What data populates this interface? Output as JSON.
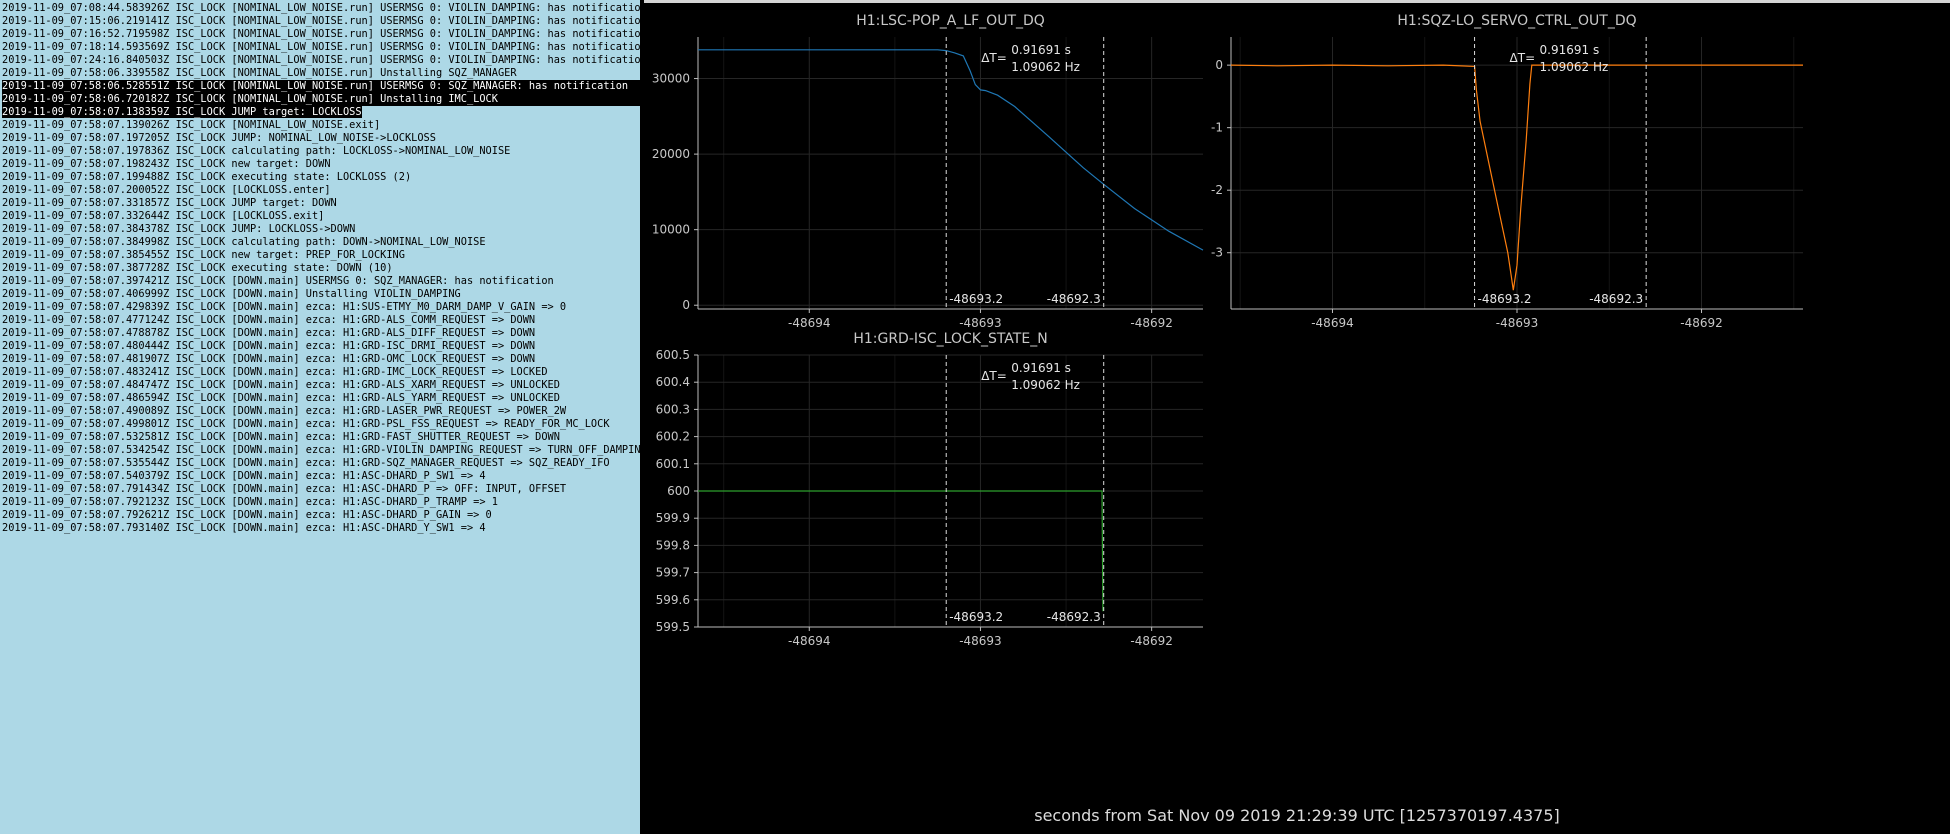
{
  "log": {
    "lines": [
      "2019-11-09_07:08:44.583926Z ISC_LOCK [NOMINAL_LOW_NOISE.run] USERMSG 0: VIOLIN_DAMPING: has notification",
      "2019-11-09_07:15:06.219141Z ISC_LOCK [NOMINAL_LOW_NOISE.run] USERMSG 0: VIOLIN_DAMPING: has notification",
      "2019-11-09_07:16:52.719598Z ISC_LOCK [NOMINAL_LOW_NOISE.run] USERMSG 0: VIOLIN_DAMPING: has notification",
      "2019-11-09_07:18:14.593569Z ISC_LOCK [NOMINAL_LOW_NOISE.run] USERMSG 0: VIOLIN_DAMPING: has notification",
      "2019-11-09_07:24:16.840503Z ISC_LOCK [NOMINAL_LOW_NOISE.run] USERMSG 0: VIOLIN_DAMPING: has notification",
      "2019-11-09_07:58:06.339558Z ISC_LOCK [NOMINAL_LOW_NOISE.run] Unstalling SQZ_MANAGER",
      "2019-11-09_07:58:06.528551Z ISC_LOCK [NOMINAL_LOW_NOISE.run] USERMSG 0: SQZ_MANAGER: has notification",
      "2019-11-09_07:58:06.720182Z ISC_LOCK [NOMINAL_LOW_NOISE.run] Unstalling IMC_LOCK",
      "2019-11-09_07:58:07.138359Z ISC_LOCK JUMP target: LOCKLOSS",
      "2019-11-09_07:58:07.139026Z ISC_LOCK [NOMINAL_LOW_NOISE.exit]",
      "2019-11-09_07:58:07.197205Z ISC_LOCK JUMP: NOMINAL_LOW_NOISE->LOCKLOSS",
      "2019-11-09_07:58:07.197836Z ISC_LOCK calculating path: LOCKLOSS->NOMINAL_LOW_NOISE",
      "2019-11-09_07:58:07.198243Z ISC_LOCK new target: DOWN",
      "2019-11-09_07:58:07.199488Z ISC_LOCK executing state: LOCKLOSS (2)",
      "2019-11-09_07:58:07.200052Z ISC_LOCK [LOCKLOSS.enter]",
      "2019-11-09_07:58:07.331857Z ISC_LOCK JUMP target: DOWN",
      "2019-11-09_07:58:07.332644Z ISC_LOCK [LOCKLOSS.exit]",
      "2019-11-09_07:58:07.384378Z ISC_LOCK JUMP: LOCKLOSS->DOWN",
      "2019-11-09_07:58:07.384998Z ISC_LOCK calculating path: DOWN->NOMINAL_LOW_NOISE",
      "2019-11-09_07:58:07.385455Z ISC_LOCK new target: PREP_FOR_LOCKING",
      "2019-11-09_07:58:07.387728Z ISC_LOCK executing state: DOWN (10)",
      "2019-11-09_07:58:07.397421Z ISC_LOCK [DOWN.main] USERMSG 0: SQZ_MANAGER: has notification",
      "2019-11-09_07:58:07.406999Z ISC_LOCK [DOWN.main] Unstalling VIOLIN_DAMPING",
      "2019-11-09_07:58:07.429839Z ISC_LOCK [DOWN.main] ezca: H1:SUS-ETMY_M0_DARM_DAMP_V_GAIN => 0",
      "2019-11-09_07:58:07.477124Z ISC_LOCK [DOWN.main] ezca: H1:GRD-ALS_COMM_REQUEST => DOWN",
      "2019-11-09_07:58:07.478878Z ISC_LOCK [DOWN.main] ezca: H1:GRD-ALS_DIFF_REQUEST => DOWN",
      "2019-11-09_07:58:07.480444Z ISC_LOCK [DOWN.main] ezca: H1:GRD-ISC_DRMI_REQUEST => DOWN",
      "2019-11-09_07:58:07.481907Z ISC_LOCK [DOWN.main] ezca: H1:GRD-OMC_LOCK_REQUEST => DOWN",
      "2019-11-09_07:58:07.483241Z ISC_LOCK [DOWN.main] ezca: H1:GRD-IMC_LOCK_REQUEST => LOCKED",
      "2019-11-09_07:58:07.484747Z ISC_LOCK [DOWN.main] ezca: H1:GRD-ALS_XARM_REQUEST => UNLOCKED",
      "2019-11-09_07:58:07.486594Z ISC_LOCK [DOWN.main] ezca: H1:GRD-ALS_YARM_REQUEST => UNLOCKED",
      "2019-11-09_07:58:07.490089Z ISC_LOCK [DOWN.main] ezca: H1:GRD-LASER_PWR_REQUEST => POWER_2W",
      "2019-11-09_07:58:07.499801Z ISC_LOCK [DOWN.main] ezca: H1:GRD-PSL_FSS_REQUEST => READY_FOR_MC_LOCK",
      "2019-11-09_07:58:07.532581Z ISC_LOCK [DOWN.main] ezca: H1:GRD-FAST_SHUTTER_REQUEST => DOWN",
      "2019-11-09_07:58:07.534254Z ISC_LOCK [DOWN.main] ezca: H1:GRD-VIOLIN_DAMPING_REQUEST => TURN_OFF_DAMPING_A",
      "2019-11-09_07:58:07.535544Z ISC_LOCK [DOWN.main] ezca: H1:GRD-SQZ_MANAGER_REQUEST => SQZ_READY_IFO",
      "2019-11-09_07:58:07.540379Z ISC_LOCK [DOWN.main] ezca: H1:ASC-DHARD_P_SW1 => 4",
      "2019-11-09_07:58:07.791434Z ISC_LOCK [DOWN.main] ezca: H1:ASC-DHARD_P => OFF: INPUT, OFFSET",
      "2019-11-09_07:58:07.792123Z ISC_LOCK [DOWN.main] ezca: H1:ASC-DHARD_P_TRAMP => 1",
      "2019-11-09_07:58:07.792621Z ISC_LOCK [DOWN.main] ezca: H1:ASC-DHARD_P_GAIN => 0",
      "2019-11-09_07:58:07.793140Z ISC_LOCK [DOWN.main] ezca: H1:ASC-DHARD_Y_SW1 => 4"
    ],
    "selected_lines": [
      6,
      7
    ],
    "partial_selected_line": 8
  },
  "colors": {
    "log_bg": "#add8e6",
    "plot_bg": "#000000",
    "grid": "#262626",
    "axis": "#bdbdbd",
    "series_blue": "#1f77b4",
    "series_orange": "#ff7f0e",
    "series_green": "#2ca02c"
  },
  "cursors": {
    "t1_label": "-48693.2",
    "t2_label": "-48692.3",
    "delta_prefix": "ΔT=",
    "delta_time": "0.91691 s",
    "delta_freq": "1.09062 Hz"
  },
  "footer": "seconds from Sat Nov 09 2019 21:29:39 UTC [1257370197.4375]",
  "chart_data": [
    {
      "type": "line",
      "title": "H1:LSC-POP_A_LF_OUT_DQ",
      "xlim": [
        -48694.65,
        -48691.7
      ],
      "ylim": [
        -500,
        35500
      ],
      "xticks": [
        -48694,
        -48693,
        -48692
      ],
      "yticks": [
        0,
        10000,
        20000,
        30000
      ],
      "cursor_x": [
        -48693.2,
        -48692.28
      ],
      "series": [
        {
          "color": "#1f77b4",
          "x": [
            -48694.65,
            -48693.8,
            -48693.5,
            -48693.25,
            -48693.2,
            -48693.15,
            -48693.1,
            -48693.06,
            -48693.03,
            -48693.0,
            -48692.97,
            -48692.9,
            -48692.8,
            -48692.6,
            -48692.4,
            -48692.28,
            -48692.1,
            -48691.9,
            -48691.7
          ],
          "y": [
            33800,
            33800,
            33800,
            33800,
            33700,
            33400,
            33000,
            31000,
            29200,
            28500,
            28400,
            27800,
            26300,
            22300,
            18200,
            16000,
            12800,
            9800,
            7300
          ]
        }
      ]
    },
    {
      "type": "line",
      "title": "H1:SQZ-LO_SERVO_CTRL_OUT_DQ",
      "xlim": [
        -48694.55,
        -48691.45
      ],
      "ylim": [
        -3.9,
        0.45
      ],
      "xticks": [
        -48694,
        -48693,
        -48692
      ],
      "yticks": [
        0,
        -1,
        -2,
        -3
      ],
      "cursor_x": [
        -48693.23,
        -48692.3
      ],
      "series": [
        {
          "color": "#ff7f0e",
          "x": [
            -48694.55,
            -48694.3,
            -48694.0,
            -48693.7,
            -48693.4,
            -48693.23,
            -48693.22,
            -48693.2,
            -48693.15,
            -48693.1,
            -48693.05,
            -48693.03,
            -48693.02,
            -48693.0,
            -48692.98,
            -48692.95,
            -48692.93,
            -48692.92,
            -48692.7,
            -48692.3,
            -48692.0,
            -48691.45
          ],
          "y": [
            0.0,
            -0.01,
            0.0,
            -0.01,
            0.0,
            -0.02,
            -0.4,
            -0.9,
            -1.6,
            -2.3,
            -3.0,
            -3.4,
            -3.6,
            -3.2,
            -2.3,
            -1.2,
            -0.3,
            0.0,
            0.0,
            0.0,
            0.0,
            0.0
          ]
        }
      ]
    },
    {
      "type": "line",
      "title": "H1:GRD-ISC_LOCK_STATE_N",
      "xlim": [
        -48694.65,
        -48691.7
      ],
      "ylim": [
        599.5,
        600.5
      ],
      "xticks": [
        -48694,
        -48693,
        -48692
      ],
      "yticks": [
        599.5,
        599.6,
        599.7,
        599.8,
        599.9,
        600,
        600.1,
        600.2,
        600.3,
        600.4,
        600.5
      ],
      "cursor_x": [
        -48693.2,
        -48692.28
      ],
      "series": [
        {
          "color": "#2ca02c",
          "x": [
            -48694.65,
            -48692.29,
            -48692.285,
            -48692.28
          ],
          "y": [
            600,
            600,
            599.56,
            599.56
          ]
        }
      ]
    }
  ]
}
